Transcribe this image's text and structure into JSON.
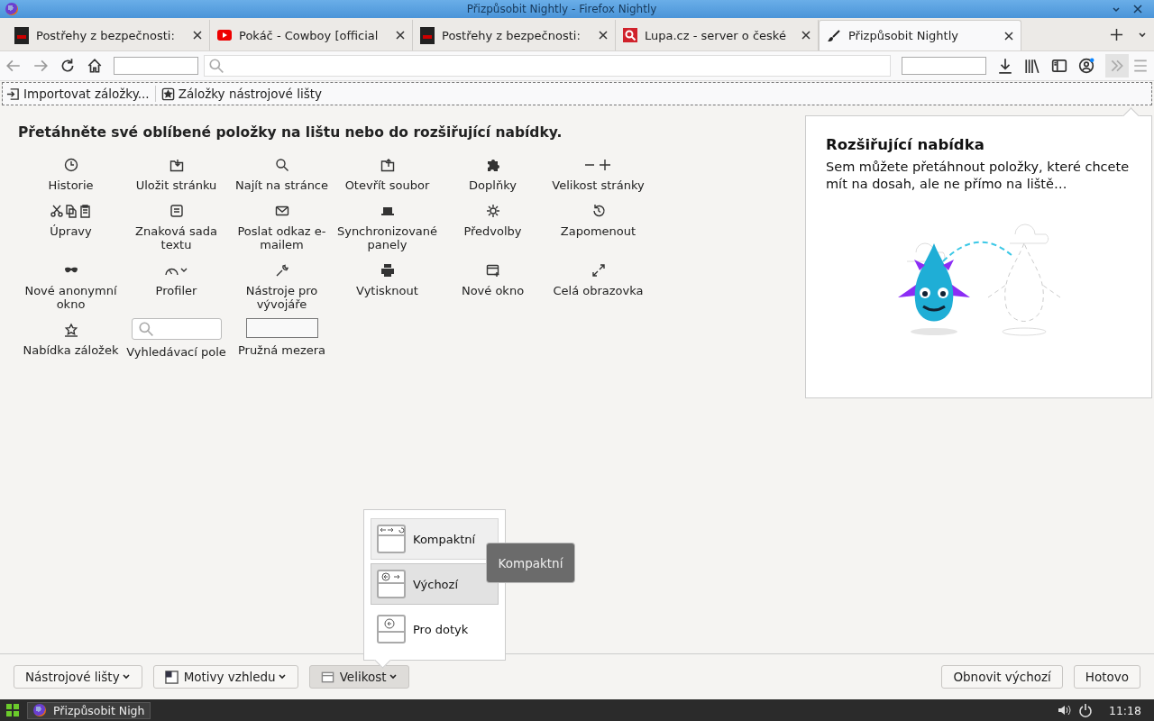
{
  "window": {
    "title": "Přizpůsobit Nightly - Firefox Nightly"
  },
  "tabs": [
    {
      "kind": "dark",
      "label": "Postřehy z bezpečnosti:",
      "selected": false
    },
    {
      "kind": "video",
      "label": "Pokáč - Cowboy [official",
      "selected": false
    },
    {
      "kind": "dark",
      "label": "Postřehy z bezpečnosti:",
      "selected": false
    },
    {
      "kind": "search",
      "label": "Lupa.cz - server o české",
      "selected": false
    },
    {
      "kind": "brush",
      "label": "Přizpůsobit Nightly",
      "selected": true
    }
  ],
  "bookmarks_toolbar": [
    {
      "kind": "import",
      "label": "Importovat záložky..."
    },
    {
      "kind": "star",
      "label": "Záložky nástrojové lišty"
    }
  ],
  "customize": {
    "heading": "Přetáhněte své oblíbené položky na lištu nebo do rozšiřující nabídky.",
    "palette": [
      {
        "kind": "button",
        "label": "Historie"
      },
      {
        "kind": "button",
        "label": "Uložit stránku"
      },
      {
        "kind": "button",
        "label": "Najít na stránce"
      },
      {
        "kind": "button",
        "label": "Otevřít soubor"
      },
      {
        "kind": "button",
        "label": "Doplňky"
      },
      {
        "kind": "button",
        "label": "Velikost stránky"
      },
      {
        "kind": "button",
        "label": "Úpravy"
      },
      {
        "kind": "button",
        "label": "Znaková sada textu"
      },
      {
        "kind": "button",
        "label": "Poslat odkaz e-mailem"
      },
      {
        "kind": "button",
        "label": "Synchronizované panely"
      },
      {
        "kind": "button",
        "label": "Předvolby"
      },
      {
        "kind": "button",
        "label": "Zapomenout"
      },
      {
        "kind": "button",
        "label": "Nové anonymní okno"
      },
      {
        "kind": "button",
        "label": "Profiler"
      },
      {
        "kind": "button",
        "label": "Nástroje pro vývojáře"
      },
      {
        "kind": "button",
        "label": "Vytisknout"
      },
      {
        "kind": "button",
        "label": "Nové okno"
      },
      {
        "kind": "button",
        "label": "Celá obrazovka"
      },
      {
        "kind": "button",
        "label": "Nabídka záložek"
      },
      {
        "kind": "search",
        "label": "Vyhledávací pole"
      },
      {
        "kind": "spacer",
        "label": "Pružná mezera"
      }
    ],
    "overflow_panel": {
      "title": "Rozšiřující nabídka",
      "description": "Sem můžete přetáhnout položky, které chcete mít na dosah, ale ne přímo na liště…"
    },
    "density_menu": {
      "items": [
        {
          "kind": "compact",
          "label": "Kompaktní",
          "hovered": true,
          "selected": false
        },
        {
          "kind": "normal",
          "label": "Výchozí",
          "hovered": false,
          "selected": true
        },
        {
          "kind": "touch",
          "label": "Pro dotyk",
          "hovered": false,
          "selected": false
        }
      ],
      "tooltip": "Kompaktní"
    },
    "bottom_bar": {
      "toolbars_button": "Nástrojové lišty",
      "themes_button": "Motivy vzhledu",
      "density_button": {
        "label": "Velikost",
        "open": true
      },
      "restore_button": "Obnovit výchozí",
      "done_button": "Hotovo"
    }
  },
  "taskbar": {
    "window_button": "Přizpůsobit Nigh",
    "clock": "11:18"
  }
}
